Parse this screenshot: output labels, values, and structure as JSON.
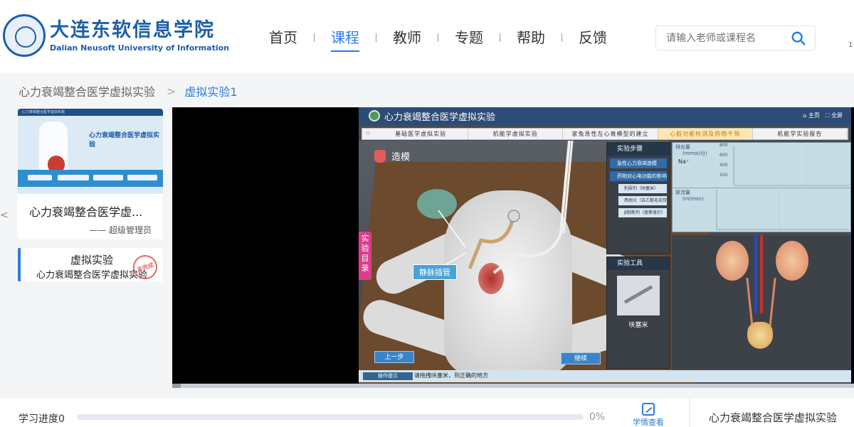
{
  "header": {
    "logo_cn": "大连东软信息学院",
    "logo_en": "Dalian Neusoft University of Information",
    "nav": [
      "首页",
      "课程",
      "教师",
      "专题",
      "帮助",
      "反馈"
    ],
    "active_nav": "课程",
    "search_placeholder": "请输入老师或课程名",
    "edge_text": "1"
  },
  "breadcrumb": {
    "root": "心力衰竭整合医学虚拟实验",
    "current": "虚拟实验1"
  },
  "course_card": {
    "thumb_top": "心力衰竭整合医学虚拟实验",
    "thumb_title": "心力衰竭整合医学虚拟实验",
    "title": "心力衰竭整合医学虚...",
    "author": "—— 超级管理员"
  },
  "experiment": {
    "title": "虚拟实验",
    "subtitle": "心力衰竭整合医学虚拟实验",
    "stamp": "未完成"
  },
  "sim": {
    "title": "心力衰竭整合医学虚拟实验",
    "home": "主页",
    "fullscreen": "全屏",
    "tabs": [
      "基础医学虚拟实验",
      "机能学虚拟实验",
      "家兔急性左心衰模型的建立",
      "心脏功能检测及药物干预",
      "机能学实验报告"
    ],
    "active_tab": 3,
    "stage_label": "造模",
    "vein_label": "静脉插管",
    "side_tab": "实验目录",
    "prev": "上一步",
    "next": "继续",
    "steps_head": "实验步骤",
    "steps": [
      "急性心力衰竭造模",
      "药物对心电功能的影响"
    ],
    "substeps": [
      "利尿剂（呋塞米）",
      "西地兰（去乙酰毛花苷）",
      "β阻断剂（普萘洛尔）"
    ],
    "tools_head": "实验工具",
    "tool_name": "呋塞米",
    "monitor_1_label": "排出量",
    "monitor_1_unit": "(mmol/分)",
    "monitor_1_na": "Na⁺",
    "monitor_1_ticks": [
      "800",
      "600",
      "400",
      "200"
    ],
    "monitor_2_label": "尿流量",
    "monitor_2_unit": "(ml/min)",
    "hint_label": "操作提示",
    "hint_text": "请拖拽呋塞米，到正确的地方"
  },
  "footer": {
    "progress_label": "学习进度0",
    "progress_value": 0,
    "progress_pct": "0%",
    "notes_label": "学情查看",
    "course_name": "心力衰竭整合医学虚拟实验"
  },
  "colors": {
    "accent": "#2a7de1",
    "brand": "#1d5fa8",
    "stamp": "#e06b6b"
  }
}
